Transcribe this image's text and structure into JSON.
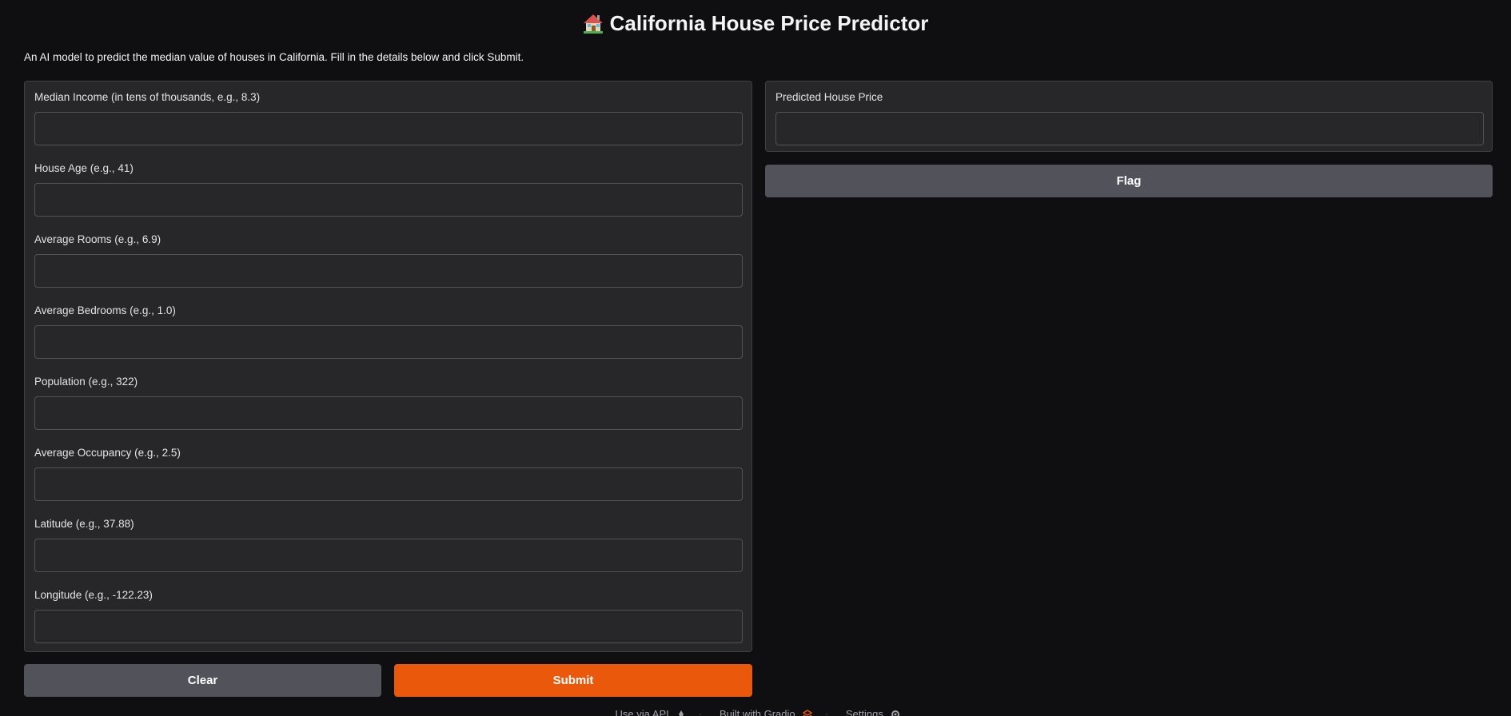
{
  "header": {
    "title": "California House Price Predictor",
    "title_icon": "house-emoji-icon",
    "description": "An AI model to predict the median value of houses in California. Fill in the details below and click Submit."
  },
  "inputs": {
    "fields": [
      {
        "label": "Median Income (in tens of thousands, e.g., 8.3)",
        "value": ""
      },
      {
        "label": "House Age (e.g., 41)",
        "value": ""
      },
      {
        "label": "Average Rooms (e.g., 6.9)",
        "value": ""
      },
      {
        "label": "Average Bedrooms (e.g., 1.0)",
        "value": ""
      },
      {
        "label": "Population (e.g., 322)",
        "value": ""
      },
      {
        "label": "Average Occupancy (e.g., 2.5)",
        "value": ""
      },
      {
        "label": "Latitude (e.g., 37.88)",
        "value": ""
      },
      {
        "label": "Longitude (e.g., -122.23)",
        "value": ""
      }
    ]
  },
  "output": {
    "label": "Predicted House Price",
    "value": ""
  },
  "buttons": {
    "clear": "Clear",
    "submit": "Submit",
    "flag": "Flag"
  },
  "footer": {
    "api": "Use via API",
    "built_with": "Built with Gradio",
    "settings": "Settings"
  },
  "colors": {
    "background": "#0f0f11",
    "panel": "#27272a",
    "primary": "#ea580c",
    "secondary": "#52525b"
  }
}
